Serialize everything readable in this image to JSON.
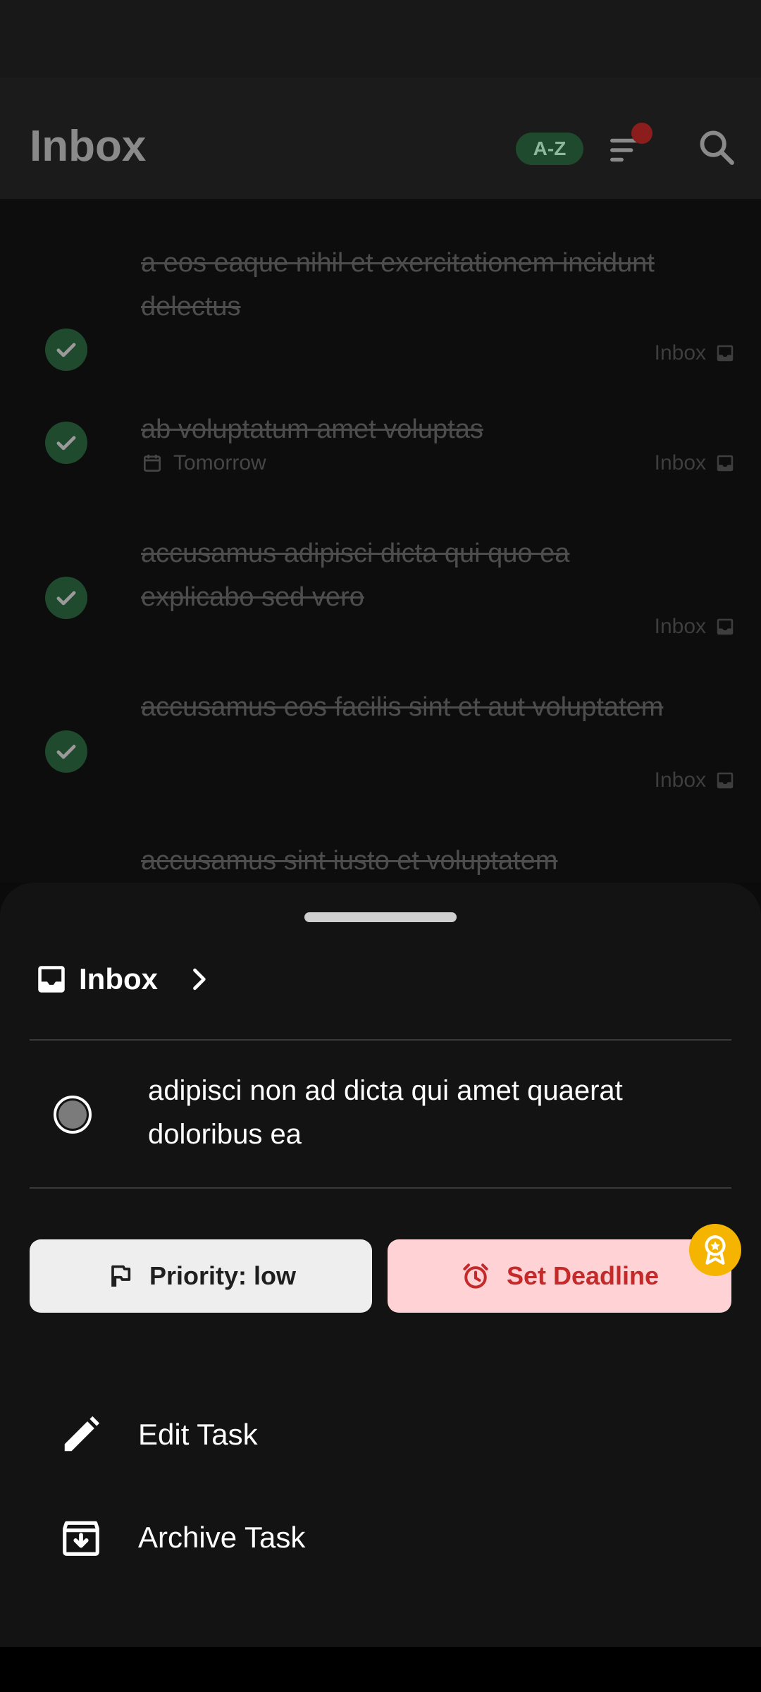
{
  "header": {
    "title": "Inbox",
    "sort_badge": "A-Z"
  },
  "tasks": [
    {
      "text": "a eos eaque nihil et exercitationem incidunt delectus",
      "project": "Inbox",
      "date": ""
    },
    {
      "text": "ab voluptatum amet voluptas",
      "project": "Inbox",
      "date": "Tomorrow"
    },
    {
      "text": "accusamus adipisci dicta qui quo ea explicabo sed vero",
      "project": "Inbox",
      "date": ""
    },
    {
      "text": "accusamus eos facilis sint et aut voluptatem",
      "project": "Inbox",
      "date": ""
    },
    {
      "text": "accusamus sint iusto et voluptatem",
      "project": "",
      "date": ""
    }
  ],
  "sheet": {
    "project": "Inbox",
    "task_text": "adipisci non ad dicta qui amet quaerat doloribus ea",
    "priority_label": "Priority: low",
    "deadline_label": "Set Deadline",
    "edit_label": "Edit Task",
    "archive_label": "Archive Task"
  },
  "colors": {
    "accent_green": "#1f4a2e",
    "notification_dot": "#8b1d1d",
    "deadline_bg": "#ffd2d5",
    "deadline_text": "#c42a2a",
    "award": "#f4b400"
  }
}
